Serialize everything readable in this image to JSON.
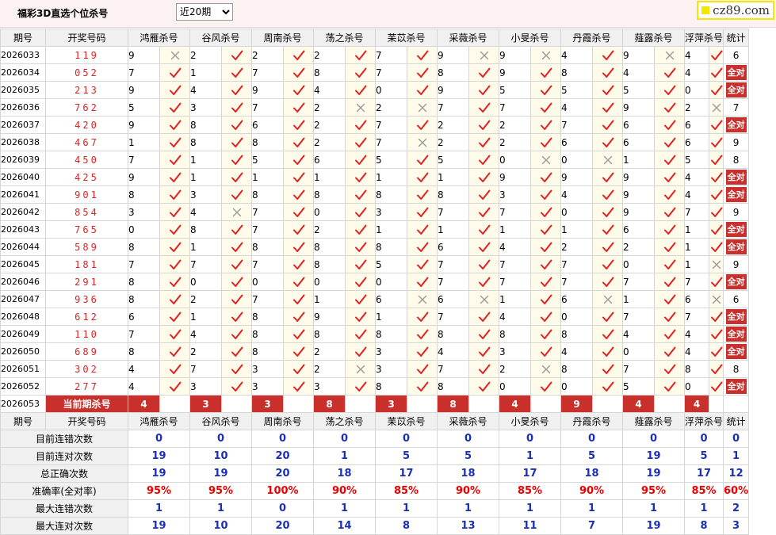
{
  "header": {
    "title": "福彩3D直选个位杀号",
    "period_selected": "近20期",
    "brand": "cz89.com"
  },
  "table": {
    "headers": [
      "期号",
      "开奖号码",
      "鸿雁杀号",
      "谷风杀号",
      "周南杀号",
      "荡之杀号",
      "苿苡杀号",
      "采薇杀号",
      "小旻杀号",
      "丹霞杀号",
      "薤露杀号",
      "浮萍杀号",
      "统计"
    ],
    "rows": [
      {
        "issue": "2026033",
        "draw": "119",
        "kills": [
          [
            9,
            0
          ],
          [
            2,
            1
          ],
          [
            2,
            1
          ],
          [
            2,
            1
          ],
          [
            7,
            1
          ],
          [
            9,
            0
          ],
          [
            9,
            0
          ],
          [
            4,
            1
          ],
          [
            9,
            0
          ],
          [
            4,
            1
          ]
        ],
        "stat": "6"
      },
      {
        "issue": "2026034",
        "draw": "052",
        "kills": [
          [
            7,
            1
          ],
          [
            1,
            1
          ],
          [
            7,
            1
          ],
          [
            8,
            1
          ],
          [
            7,
            1
          ],
          [
            8,
            1
          ],
          [
            9,
            1
          ],
          [
            8,
            1
          ],
          [
            4,
            1
          ],
          [
            4,
            1
          ]
        ],
        "stat": "全对"
      },
      {
        "issue": "2026035",
        "draw": "213",
        "kills": [
          [
            9,
            1
          ],
          [
            4,
            1
          ],
          [
            9,
            1
          ],
          [
            4,
            1
          ],
          [
            0,
            1
          ],
          [
            9,
            1
          ],
          [
            5,
            1
          ],
          [
            5,
            1
          ],
          [
            5,
            1
          ],
          [
            0,
            1
          ]
        ],
        "stat": "全对"
      },
      {
        "issue": "2026036",
        "draw": "762",
        "kills": [
          [
            5,
            1
          ],
          [
            3,
            1
          ],
          [
            7,
            1
          ],
          [
            2,
            0
          ],
          [
            2,
            0
          ],
          [
            7,
            1
          ],
          [
            7,
            1
          ],
          [
            4,
            1
          ],
          [
            9,
            1
          ],
          [
            2,
            0
          ]
        ],
        "stat": "7"
      },
      {
        "issue": "2026037",
        "draw": "420",
        "kills": [
          [
            9,
            1
          ],
          [
            8,
            1
          ],
          [
            6,
            1
          ],
          [
            2,
            1
          ],
          [
            7,
            1
          ],
          [
            2,
            1
          ],
          [
            2,
            1
          ],
          [
            7,
            1
          ],
          [
            6,
            1
          ],
          [
            6,
            1
          ]
        ],
        "stat": "全对"
      },
      {
        "issue": "2026038",
        "draw": "467",
        "kills": [
          [
            1,
            1
          ],
          [
            8,
            1
          ],
          [
            8,
            1
          ],
          [
            2,
            1
          ],
          [
            7,
            0
          ],
          [
            2,
            1
          ],
          [
            2,
            1
          ],
          [
            6,
            1
          ],
          [
            6,
            1
          ],
          [
            6,
            1
          ]
        ],
        "stat": "9"
      },
      {
        "issue": "2026039",
        "draw": "450",
        "kills": [
          [
            7,
            1
          ],
          [
            1,
            1
          ],
          [
            5,
            1
          ],
          [
            6,
            1
          ],
          [
            5,
            1
          ],
          [
            5,
            1
          ],
          [
            0,
            0
          ],
          [
            0,
            0
          ],
          [
            1,
            1
          ],
          [
            5,
            1
          ]
        ],
        "stat": "8"
      },
      {
        "issue": "2026040",
        "draw": "425",
        "kills": [
          [
            9,
            1
          ],
          [
            1,
            1
          ],
          [
            1,
            1
          ],
          [
            1,
            1
          ],
          [
            1,
            1
          ],
          [
            1,
            1
          ],
          [
            9,
            1
          ],
          [
            9,
            1
          ],
          [
            9,
            1
          ],
          [
            4,
            1
          ]
        ],
        "stat": "全对"
      },
      {
        "issue": "2026041",
        "draw": "901",
        "kills": [
          [
            8,
            1
          ],
          [
            3,
            1
          ],
          [
            8,
            1
          ],
          [
            8,
            1
          ],
          [
            8,
            1
          ],
          [
            8,
            1
          ],
          [
            3,
            1
          ],
          [
            4,
            1
          ],
          [
            9,
            1
          ],
          [
            4,
            1
          ]
        ],
        "stat": "全对"
      },
      {
        "issue": "2026042",
        "draw": "854",
        "kills": [
          [
            3,
            1
          ],
          [
            4,
            0
          ],
          [
            7,
            1
          ],
          [
            0,
            1
          ],
          [
            3,
            1
          ],
          [
            7,
            1
          ],
          [
            7,
            1
          ],
          [
            0,
            1
          ],
          [
            9,
            1
          ],
          [
            7,
            1
          ]
        ],
        "stat": "9"
      },
      {
        "issue": "2026043",
        "draw": "765",
        "kills": [
          [
            0,
            1
          ],
          [
            8,
            1
          ],
          [
            7,
            1
          ],
          [
            2,
            1
          ],
          [
            1,
            1
          ],
          [
            1,
            1
          ],
          [
            1,
            1
          ],
          [
            1,
            1
          ],
          [
            6,
            1
          ],
          [
            1,
            1
          ]
        ],
        "stat": "全对"
      },
      {
        "issue": "2026044",
        "draw": "589",
        "kills": [
          [
            8,
            1
          ],
          [
            1,
            1
          ],
          [
            8,
            1
          ],
          [
            8,
            1
          ],
          [
            8,
            1
          ],
          [
            6,
            1
          ],
          [
            4,
            1
          ],
          [
            2,
            1
          ],
          [
            2,
            1
          ],
          [
            1,
            1
          ]
        ],
        "stat": "全对"
      },
      {
        "issue": "2026045",
        "draw": "181",
        "kills": [
          [
            7,
            1
          ],
          [
            7,
            1
          ],
          [
            7,
            1
          ],
          [
            8,
            1
          ],
          [
            5,
            1
          ],
          [
            7,
            1
          ],
          [
            7,
            1
          ],
          [
            7,
            1
          ],
          [
            0,
            1
          ],
          [
            1,
            0
          ]
        ],
        "stat": "9"
      },
      {
        "issue": "2026046",
        "draw": "291",
        "kills": [
          [
            8,
            1
          ],
          [
            0,
            1
          ],
          [
            0,
            1
          ],
          [
            0,
            1
          ],
          [
            0,
            1
          ],
          [
            7,
            1
          ],
          [
            7,
            1
          ],
          [
            7,
            1
          ],
          [
            7,
            1
          ],
          [
            7,
            1
          ]
        ],
        "stat": "全对"
      },
      {
        "issue": "2026047",
        "draw": "936",
        "kills": [
          [
            8,
            1
          ],
          [
            2,
            1
          ],
          [
            7,
            1
          ],
          [
            1,
            1
          ],
          [
            6,
            0
          ],
          [
            6,
            0
          ],
          [
            1,
            1
          ],
          [
            6,
            0
          ],
          [
            1,
            1
          ],
          [
            6,
            0
          ]
        ],
        "stat": "6"
      },
      {
        "issue": "2026048",
        "draw": "612",
        "kills": [
          [
            6,
            1
          ],
          [
            1,
            1
          ],
          [
            8,
            1
          ],
          [
            9,
            1
          ],
          [
            1,
            1
          ],
          [
            7,
            1
          ],
          [
            4,
            1
          ],
          [
            0,
            1
          ],
          [
            7,
            1
          ],
          [
            7,
            1
          ]
        ],
        "stat": "全对"
      },
      {
        "issue": "2026049",
        "draw": "110",
        "kills": [
          [
            7,
            1
          ],
          [
            4,
            1
          ],
          [
            8,
            1
          ],
          [
            8,
            1
          ],
          [
            8,
            1
          ],
          [
            8,
            1
          ],
          [
            8,
            1
          ],
          [
            8,
            1
          ],
          [
            4,
            1
          ],
          [
            4,
            1
          ]
        ],
        "stat": "全对"
      },
      {
        "issue": "2026050",
        "draw": "689",
        "kills": [
          [
            8,
            1
          ],
          [
            2,
            1
          ],
          [
            8,
            1
          ],
          [
            2,
            1
          ],
          [
            3,
            1
          ],
          [
            4,
            1
          ],
          [
            3,
            1
          ],
          [
            4,
            1
          ],
          [
            0,
            1
          ],
          [
            4,
            1
          ]
        ],
        "stat": "全对"
      },
      {
        "issue": "2026051",
        "draw": "302",
        "kills": [
          [
            4,
            1
          ],
          [
            7,
            1
          ],
          [
            3,
            1
          ],
          [
            2,
            0
          ],
          [
            3,
            1
          ],
          [
            7,
            1
          ],
          [
            2,
            0
          ],
          [
            8,
            1
          ],
          [
            7,
            1
          ],
          [
            8,
            1
          ]
        ],
        "stat": "8"
      },
      {
        "issue": "2026052",
        "draw": "277",
        "kills": [
          [
            4,
            1
          ],
          [
            3,
            1
          ],
          [
            3,
            1
          ],
          [
            3,
            1
          ],
          [
            8,
            1
          ],
          [
            8,
            1
          ],
          [
            0,
            1
          ],
          [
            0,
            1
          ],
          [
            5,
            1
          ],
          [
            0,
            1
          ]
        ],
        "stat": "全对"
      }
    ],
    "current": {
      "issue": "2026053",
      "label": "当前期杀号",
      "kills": [
        "4",
        "3",
        "3",
        "8",
        "3",
        "8",
        "4",
        "9",
        "4",
        "4"
      ]
    },
    "stats": [
      {
        "label": "目前连错次数",
        "values": [
          "0",
          "0",
          "0",
          "0",
          "0",
          "0",
          "0",
          "0",
          "0",
          "0",
          "0"
        ],
        "red": false
      },
      {
        "label": "目前连对次数",
        "values": [
          "19",
          "10",
          "20",
          "1",
          "5",
          "5",
          "1",
          "5",
          "19",
          "5",
          "1"
        ],
        "red": false
      },
      {
        "label": "总正确次数",
        "values": [
          "19",
          "19",
          "20",
          "18",
          "17",
          "18",
          "17",
          "18",
          "19",
          "17",
          "12"
        ],
        "red": false
      },
      {
        "label": "准确率(全对率)",
        "values": [
          "95%",
          "95%",
          "100%",
          "90%",
          "85%",
          "90%",
          "85%",
          "90%",
          "95%",
          "85%",
          "60%"
        ],
        "red": true
      },
      {
        "label": "最大连错次数",
        "values": [
          "1",
          "1",
          "0",
          "1",
          "1",
          "1",
          "1",
          "1",
          "1",
          "1",
          "2"
        ],
        "red": false
      },
      {
        "label": "最大连对次数",
        "values": [
          "19",
          "10",
          "20",
          "14",
          "8",
          "13",
          "11",
          "7",
          "19",
          "8",
          "3"
        ],
        "red": false
      }
    ]
  },
  "colors": {
    "accent_red": "#c9302c",
    "check_red": "#e02020",
    "cross_gray": "#999999",
    "stat_blue": "#1a2fb5"
  }
}
